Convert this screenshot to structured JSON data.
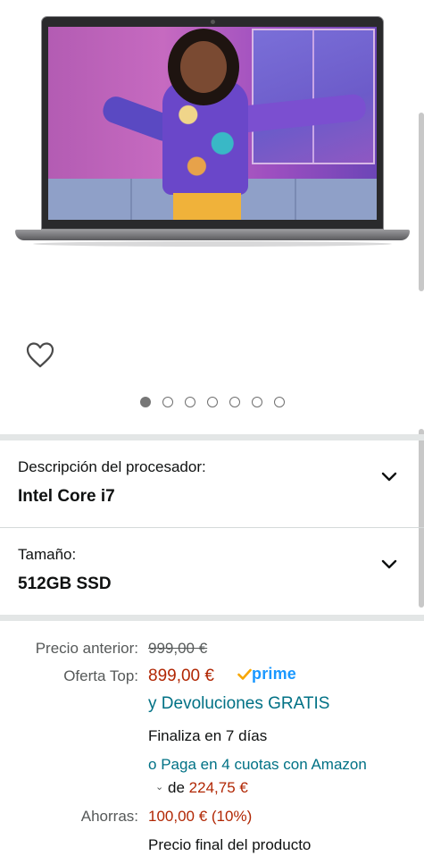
{
  "gallery": {
    "image_count": 7,
    "active_index": 0
  },
  "variations": [
    {
      "label": "Descripción del procesador:",
      "value": "Intel Core i7"
    },
    {
      "label": "Tamaño:",
      "value": "512GB SSD"
    }
  ],
  "price": {
    "previous_label": "Precio anterior:",
    "previous_value": "999,00 €",
    "offer_label": "Oferta Top:",
    "offer_value": "899,00 €",
    "prime_text": "prime",
    "returns_text": "y Devoluciones GRATIS",
    "ends_text": "Finaliza en 7 días",
    "installments_bullet": "o",
    "installments_link": "Paga en 4 cuotas con Amazon",
    "installments_prefix": "de",
    "installments_amount": "224,75 €",
    "savings_label": "Ahorras:",
    "savings_value": "100,00 € (10%)",
    "final_price_text": "Precio final del producto"
  },
  "colors": {
    "price": "#b12704",
    "link": "#007185",
    "prime_blue": "#1a98ff",
    "prime_check": "#f7a600"
  },
  "icons": {
    "wishlist": "heart-outline-icon",
    "dropdown": "chevron-down-icon",
    "prime_check": "checkmark-icon"
  }
}
